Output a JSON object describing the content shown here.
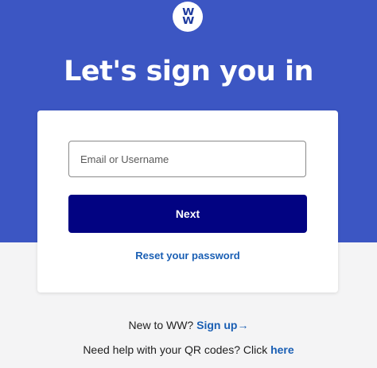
{
  "brand": {
    "logo_line1": "W",
    "logo_line2": "W",
    "logo_name": "ww-logo"
  },
  "header": {
    "title": "Let's sign you in"
  },
  "login_form": {
    "email_placeholder": "Email or Username",
    "email_value": "",
    "next_label": "Next",
    "reset_link": "Reset your password"
  },
  "footer": {
    "new_prefix": "New to WW?",
    "signup_link": "Sign up→",
    "qr_prefix": "Need help with your QR codes? Click",
    "qr_link": "here"
  },
  "colors": {
    "hero_background": "#3c56c3",
    "primary_button": "#020382",
    "link": "#1a5fb4",
    "page_background": "#f4f4f5"
  }
}
